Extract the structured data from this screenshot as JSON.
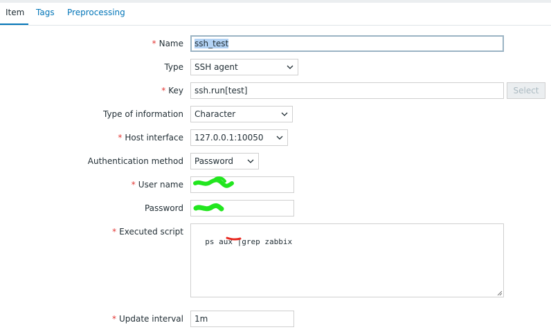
{
  "tabs": [
    {
      "label": "Item",
      "active": true
    },
    {
      "label": "Tags",
      "active": false
    },
    {
      "label": "Preprocessing",
      "active": false
    }
  ],
  "form": {
    "name": {
      "label": "Name",
      "required": true,
      "value": "ssh_test"
    },
    "type": {
      "label": "Type",
      "required": false,
      "value": "SSH agent"
    },
    "key": {
      "label": "Key",
      "required": true,
      "value": "ssh.run[test]",
      "button": "Select"
    },
    "type_of_information": {
      "label": "Type of information",
      "required": false,
      "value": "Character"
    },
    "host_interface": {
      "label": "Host interface",
      "required": true,
      "value": "127.0.0.1:10050"
    },
    "auth_method": {
      "label": "Authentication method",
      "required": false,
      "value": "Password"
    },
    "user_name": {
      "label": "User name",
      "required": true,
      "value": ""
    },
    "password": {
      "label": "Password",
      "required": false,
      "value": ""
    },
    "executed_script": {
      "label": "Executed script",
      "required": true,
      "value": "ps aux |grep zabbix"
    },
    "update_interval": {
      "label": "Update interval",
      "required": true,
      "value": "1m"
    }
  },
  "required_marker": "*",
  "colors": {
    "link": "#0275b8",
    "required": "#e33734",
    "redaction": "#22e61f",
    "annotation": "#e8251c"
  }
}
